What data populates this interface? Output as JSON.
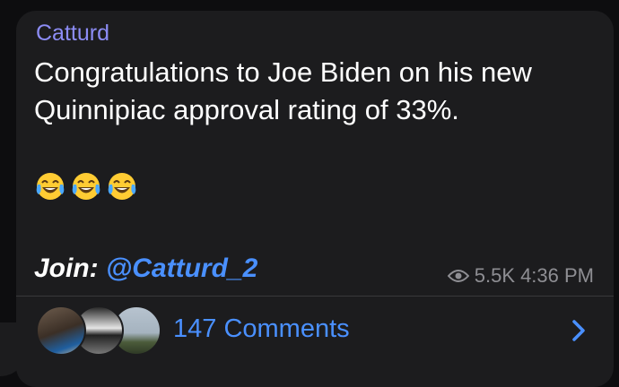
{
  "post": {
    "sender": "Catturd",
    "message": "Congratulations to Joe Biden on his new\nQuinnipiac approval rating of 33%.",
    "emojis": [
      "face-with-tears-of-joy",
      "face-with-tears-of-joy",
      "face-with-tears-of-joy"
    ],
    "join_label": "Join: ",
    "join_link": "@Catturd_2",
    "views": "5.5K",
    "time": "4:36 PM"
  },
  "comments": {
    "label": "147 Comments"
  },
  "colors": {
    "bubble": "#1c1c1e",
    "sender": "#8c8cf5",
    "link": "#4a90ff",
    "meta": "#8e8e93"
  }
}
